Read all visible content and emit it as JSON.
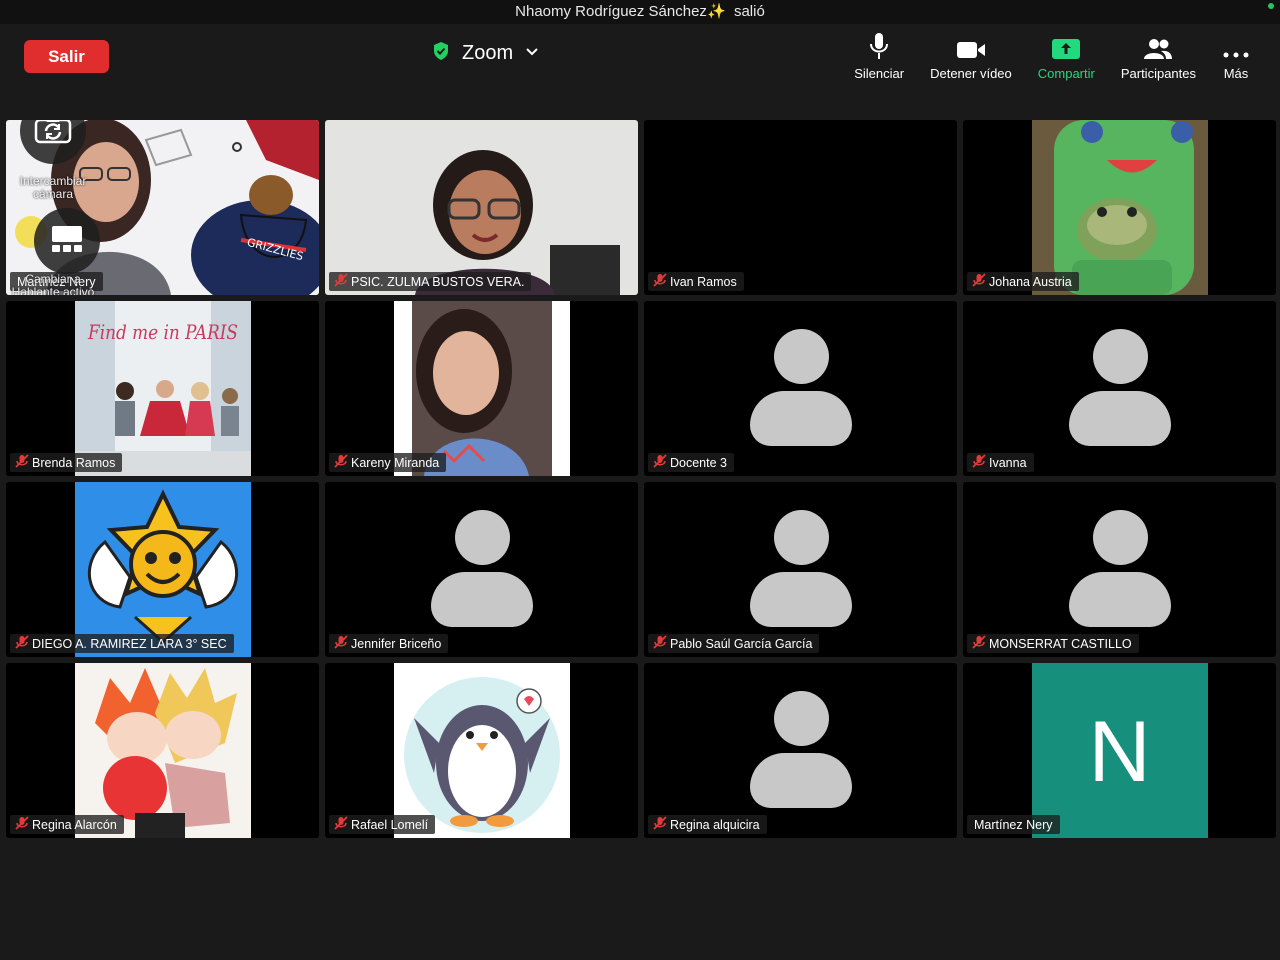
{
  "banner": {
    "message": "Nhaomy Rodríguez Sánchez",
    "emoji": "✨",
    "suffix": "salió"
  },
  "toolbar": {
    "leave_label": "Salir",
    "meeting_title": "Zoom",
    "mute_label": "Silenciar",
    "video_label": "Detener vídeo",
    "share_label": "Compartir",
    "participants_label": "Participantes",
    "more_label": "Más"
  },
  "self_overlay": {
    "switch_camera_label": "Intercambiar cámara",
    "switch_view_label": "Cambiar a Hablante activo"
  },
  "participants": [
    {
      "name": "Martínez Nery",
      "muted": false,
      "kind": "video",
      "active": true
    },
    {
      "name": "PSIC. ZULMA BUSTOS VERA.",
      "muted": true,
      "kind": "video"
    },
    {
      "name": "Ivan  Ramos",
      "muted": true,
      "kind": "black"
    },
    {
      "name": "Johana Austria",
      "muted": true,
      "kind": "image"
    },
    {
      "name": "Brenda Ramos",
      "muted": true,
      "kind": "image",
      "poster_text": "Find me in PARIS"
    },
    {
      "name": "Kareny Miranda",
      "muted": true,
      "kind": "image"
    },
    {
      "name": "Docente 3",
      "muted": true,
      "kind": "avatar"
    },
    {
      "name": "Ivanna",
      "muted": true,
      "kind": "avatar"
    },
    {
      "name": "DIEGO A. RAMIREZ LARA 3° SEC",
      "muted": true,
      "kind": "image"
    },
    {
      "name": "Jennifer Briceño",
      "muted": true,
      "kind": "avatar"
    },
    {
      "name": "Pablo Saúl García García",
      "muted": true,
      "kind": "avatar"
    },
    {
      "name": "MONSERRAT CASTILLO",
      "muted": true,
      "kind": "avatar"
    },
    {
      "name": "Regina Alarcón",
      "muted": true,
      "kind": "image"
    },
    {
      "name": "Rafael Lomelí",
      "muted": true,
      "kind": "image"
    },
    {
      "name": "Regina alquicira",
      "muted": true,
      "kind": "avatar"
    },
    {
      "name": "Martínez Nery",
      "muted": false,
      "kind": "initial",
      "initial": "N"
    }
  ],
  "colors": {
    "leave_button": "#e02d2d",
    "active_speaker_border": "#23d160",
    "share_green": "#23d97d",
    "mute_red": "#e23a3a",
    "initial_tile": "#16907d"
  },
  "icons": [
    "shield-check-icon",
    "chevron-down-icon",
    "microphone-icon",
    "video-camera-icon",
    "share-screen-icon",
    "participants-icon",
    "more-icon",
    "camera-switch-icon",
    "gallery-view-icon",
    "muted-microphone-icon"
  ]
}
